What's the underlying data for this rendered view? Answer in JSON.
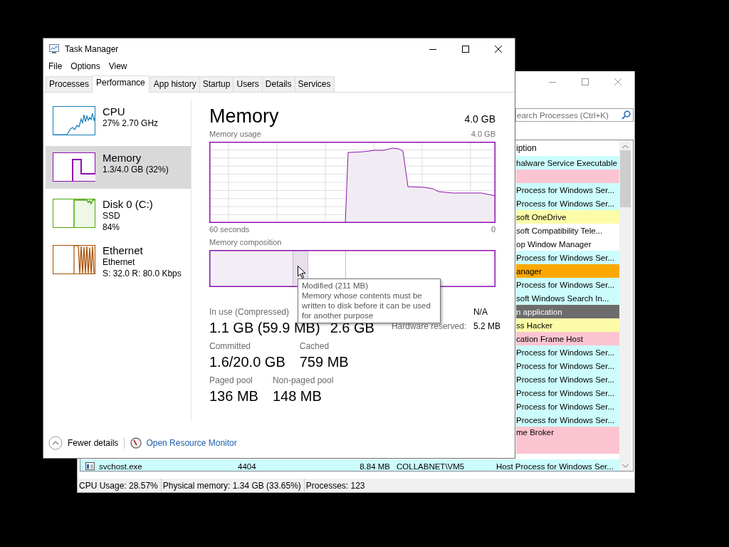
{
  "background_window": {
    "search": {
      "placeholder": "earch Processes (Ctrl+K)"
    },
    "list": {
      "header": "iption",
      "rows": [
        {
          "kind": "partial",
          "description": "halware Service Executable",
          "color": "#ccfcfc"
        },
        {
          "kind": "partial",
          "color": "#fcc4d0"
        },
        {
          "kind": "partial",
          "description": "Process for Windows Ser...",
          "color": "#ccfcfc"
        },
        {
          "kind": "partial",
          "description": "Process for Windows Ser...",
          "color": "#ccfcfc"
        },
        {
          "kind": "partial",
          "description": "soft OneDrive",
          "color": "#fcfca8"
        },
        {
          "kind": "partial",
          "description": "soft Compatibility Tele...",
          "color": "#ffffff"
        },
        {
          "kind": "partial",
          "description": "op Window Manager",
          "color": "#ffffff"
        },
        {
          "kind": "partial",
          "description": "Process for Windows Ser...",
          "color": "#ccfcfc"
        },
        {
          "kind": "partial",
          "description": "anager",
          "color": "#fca800"
        },
        {
          "kind": "partial",
          "description": "Process for Windows Ser...",
          "color": "#ccfcfc"
        },
        {
          "kind": "partial",
          "description": "soft Windows Search In...",
          "color": "#ccfcfc"
        },
        {
          "kind": "partial",
          "description": "n application",
          "color": "#6c6c6c"
        },
        {
          "kind": "partial",
          "description": "ss Hacker",
          "color": "#fcfca8"
        },
        {
          "kind": "partial",
          "description": "cation Frame Host",
          "color": "#fcc4d0"
        },
        {
          "kind": "partial",
          "description": "Process for Windows Ser...",
          "color": "#ccfcfc"
        },
        {
          "kind": "partial",
          "description": "Process for Windows Ser...",
          "color": "#ccfcfc"
        },
        {
          "kind": "partial",
          "description": "Process for Windows Ser...",
          "color": "#ccfcfc"
        },
        {
          "kind": "partial",
          "description": "Process for Windows Ser...",
          "color": "#ccfcfc"
        },
        {
          "kind": "partial",
          "description": "Process for Windows Ser...",
          "color": "#ccfcfc"
        },
        {
          "kind": "partial",
          "description": "Process for Windows Ser...",
          "color": "#ccfcfc"
        },
        {
          "kind": "tall",
          "description": "me Broker",
          "color": "#fcc4d0"
        },
        {
          "kind": "full",
          "name": "svchost.exe",
          "pid": "4404",
          "memory": "8.84 MB",
          "user": "COLLABNET\\VM5",
          "description": "Host Process for Windows Ser...",
          "color": "#ccfcfc"
        }
      ]
    },
    "status_bar": [
      "CPU Usage: 28.57%",
      "Physical memory: 1.34 GB (33.65%)",
      "Processes: 123"
    ]
  },
  "task_manager": {
    "title": "Task Manager",
    "menu": [
      "File",
      "Options",
      "View"
    ],
    "tabs": [
      {
        "label": "Processes",
        "selected": false
      },
      {
        "label": "Performance",
        "selected": true
      },
      {
        "label": "App history",
        "selected": false
      },
      {
        "label": "Startup",
        "selected": false
      },
      {
        "label": "Users",
        "selected": false
      },
      {
        "label": "Details",
        "selected": false
      },
      {
        "label": "Services",
        "selected": false
      }
    ],
    "sidebar": [
      {
        "kind": "cpu",
        "name": "CPU",
        "lines": [
          "27%  2.70 GHz"
        ],
        "color": "#117dbb",
        "selected": false
      },
      {
        "kind": "memory",
        "name": "Memory",
        "lines": [
          "1.3/4.0 GB (32%)"
        ],
        "color": "#8b12ae",
        "selected": true
      },
      {
        "kind": "disk",
        "name": "Disk 0 (C:)",
        "lines": [
          "SSD",
          "84%"
        ],
        "color": "#4da60c",
        "selected": false
      },
      {
        "kind": "network",
        "name": "Ethernet",
        "lines": [
          "Ethernet",
          "S: 32.0 R: 80.0 Kbps"
        ],
        "color": "#a74f01",
        "selected": false
      }
    ],
    "detail": {
      "title": "Memory",
      "total": "4.0 GB",
      "usage_label": "Memory usage",
      "usage_max": "4.0 GB",
      "time_span": "60 seconds",
      "time_end": "0",
      "composition_label": "Memory composition",
      "stats": [
        [
          {
            "label": "In use (Compressed)",
            "value": "1.1 GB (59.9 MB)"
          },
          {
            "value": "2.6 GB"
          }
        ],
        [
          {
            "label": "Committed",
            "value": "1.6/20.0 GB"
          },
          {
            "label": "Cached",
            "value": "759 MB"
          }
        ],
        [
          {
            "label": "Paged pool",
            "value": "136 MB"
          },
          {
            "label": "Non-paged pool",
            "value": "148 MB"
          }
        ]
      ],
      "side_stats": [
        {
          "value": "N/A"
        },
        {
          "label": "Hardware reserved:",
          "value": "5.2 MB"
        }
      ],
      "tooltip": {
        "title": "Modified (211 MB)",
        "text": "Memory whose contents must be written to disk before it can be used for another purpose"
      }
    },
    "footer": {
      "fewer_details": "Fewer details",
      "resource_monitor": "Open Resource Monitor"
    }
  }
}
